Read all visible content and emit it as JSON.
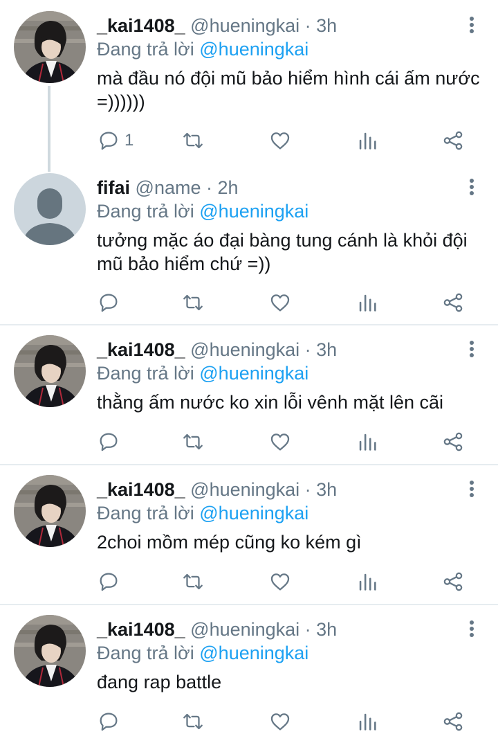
{
  "tweets": [
    {
      "display_name": "_kai1408_",
      "handle": "@hueningkai · 3h",
      "reply_prefix": "Đang trả lời ",
      "reply_to": "@hueningkai",
      "text": "mà đầu nó đội mũ bảo hiểm hình cái ấm nước =))))))",
      "reply_count": "1",
      "avatar": "photo"
    },
    {
      "display_name": "fifai",
      "handle": "@name · 2h",
      "reply_prefix": "Đang trả lời ",
      "reply_to": "@hueningkai",
      "text": "tưởng mặc áo đại bàng tung cánh là khỏi đội mũ bảo hiểm chứ =))",
      "reply_count": "",
      "avatar": "default"
    },
    {
      "display_name": "_kai1408_",
      "handle": "@hueningkai · 3h",
      "reply_prefix": "Đang trả lời ",
      "reply_to": "@hueningkai",
      "text": "thằng ấm nước ko xin lỗi vênh mặt lên cãi",
      "reply_count": "",
      "avatar": "photo"
    },
    {
      "display_name": "_kai1408_",
      "handle": "@hueningkai · 3h",
      "reply_prefix": "Đang trả lời ",
      "reply_to": "@hueningkai",
      "text": "2choi mồm mép cũng ko kém gì",
      "reply_count": "",
      "avatar": "photo"
    },
    {
      "display_name": "_kai1408_",
      "handle": "@hueningkai · 3h",
      "reply_prefix": "Đang trả lời ",
      "reply_to": "@hueningkai",
      "text": "đang rap battle",
      "reply_count": "",
      "avatar": "photo"
    }
  ],
  "colors": {
    "accent": "#1da1f2",
    "secondary_text": "#657786",
    "divider": "#e6ecf0",
    "default_avatar_bg": "#ccd6dd",
    "default_avatar_fg": "#66757f"
  },
  "icons": [
    "reply-icon",
    "retweet-icon",
    "like-icon",
    "stats-icon",
    "share-icon",
    "more-options-icon"
  ]
}
